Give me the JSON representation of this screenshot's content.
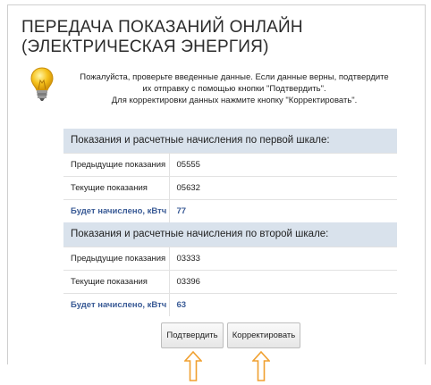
{
  "page": {
    "title_line1": "ПЕРЕДАЧА ПОКАЗАНИЙ ОНЛАЙН",
    "title_line2": "(ЭЛЕКТРИЧЕСКАЯ ЭНЕРГИЯ)"
  },
  "hint": {
    "icon": "lightbulb-icon",
    "line1": "Пожалуйста, проверьте введенные данные. Если данные верны, подтвердите",
    "line2": "их отправку с помощью кнопки \"Подтвердить\".",
    "line3": "Для корректировки данных нажмите кнопку \"Корректировать\"."
  },
  "scale1": {
    "header": "Показания и расчетные начисления по первой шкале:",
    "rows": [
      {
        "label": "Предыдущие показания",
        "value": "05555"
      },
      {
        "label": "Текущие показания",
        "value": "05632"
      },
      {
        "label": "Будет начислено, кВтч",
        "value": "77"
      }
    ]
  },
  "scale2": {
    "header": "Показания и расчетные начисления по второй шкале:",
    "rows": [
      {
        "label": "Предыдущие показания",
        "value": "03333"
      },
      {
        "label": "Текущие показания",
        "value": "03396"
      },
      {
        "label": "Будет начислено, кВтч",
        "value": "63"
      }
    ]
  },
  "buttons": {
    "confirm_label": "Подтвердить",
    "correct_label": "Корректировать"
  },
  "colors": {
    "section_header_bg": "#d9e2ec",
    "total_text": "#3a5b96",
    "arrow": "#f0a030",
    "bulb": "#f6c21c"
  }
}
